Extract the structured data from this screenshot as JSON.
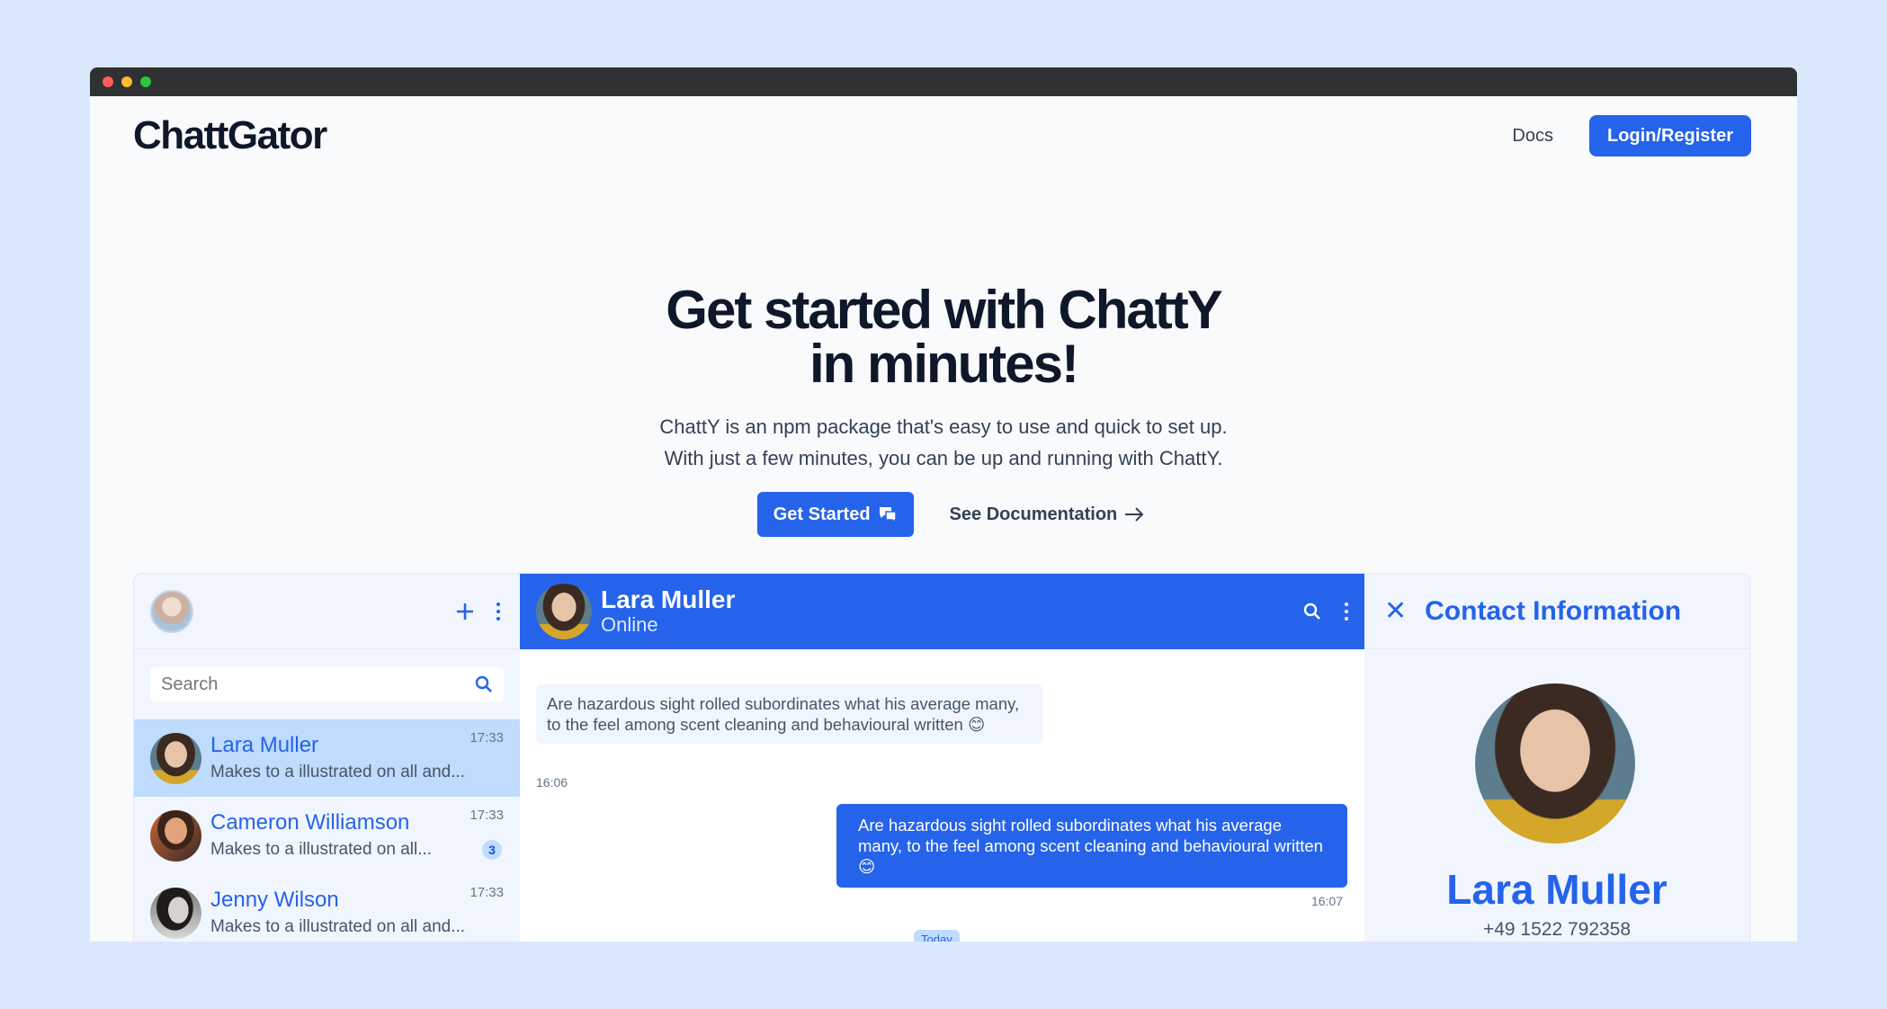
{
  "brand": {
    "logo": "ChattGator"
  },
  "nav": {
    "docs_label": "Docs",
    "login_label": "Login/Register"
  },
  "hero": {
    "title_line1": "Get started with ChattY",
    "title_line2": "in minutes!",
    "desc_line1": "ChattY is an npm package that's easy to use and quick to set up.",
    "desc_line2": "With just a few minutes, you can be up and running with ChattY.",
    "get_started_label": "Get Started",
    "see_docs_label": "See Documentation"
  },
  "sidebar": {
    "search_placeholder": "Search",
    "contacts": [
      {
        "name": "Lara Muller",
        "preview": "Makes to a illustrated on all and...",
        "time": "17:33",
        "badge": ""
      },
      {
        "name": "Cameron Williamson",
        "preview": "Makes to a illustrated on all...",
        "time": "17:33",
        "badge": "3"
      },
      {
        "name": "Jenny Wilson",
        "preview": "Makes to a illustrated on all and...",
        "time": "17:33",
        "badge": ""
      }
    ]
  },
  "chat": {
    "name": "Lara Muller",
    "status": "Online",
    "messages": [
      {
        "direction": "in",
        "text": "Are hazardous sight rolled subordinates what his average many, to the feel among scent cleaning and behavioural written 😊",
        "time": "16:06"
      },
      {
        "direction": "out",
        "text": "Are hazardous sight rolled subordinates what his average many, to the feel among scent cleaning and behavioural written 😊",
        "time": "16:07"
      }
    ],
    "divider": "Today"
  },
  "info": {
    "title": "Contact Information",
    "name": "Lara Muller",
    "phone": "+49 1522 792358"
  },
  "colors": {
    "accent": "#2563eb",
    "accent_light": "#bfdbfe",
    "panel_bg": "#f1f6fe",
    "page_bg": "#dbe8fc"
  }
}
